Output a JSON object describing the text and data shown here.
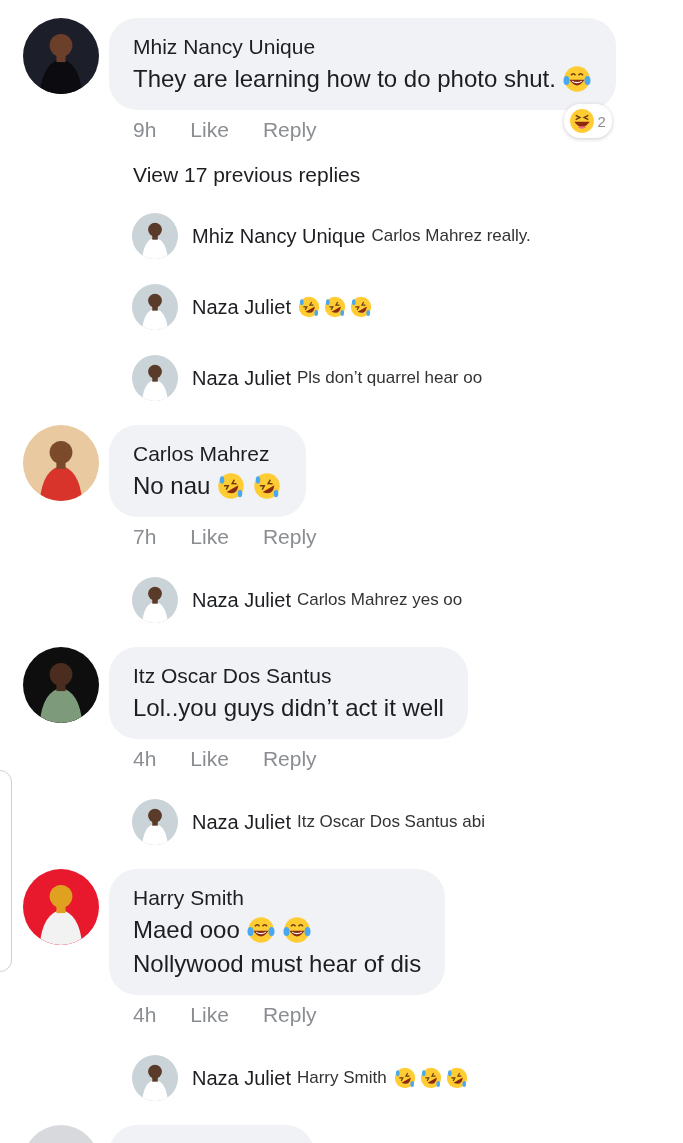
{
  "comments": [
    {
      "kind": "full",
      "author": "Mhiz Nancy Unique",
      "lines": [
        {
          "text": "They are learning how to do photo shut.",
          "emojis": [
            {
              "kind": "tears-of-joy"
            }
          ]
        }
      ],
      "time": "9h",
      "like": "Like",
      "reply": "Reply",
      "reaction": {
        "kind": "grinning-squint",
        "count": "2"
      },
      "view_replies": "View 17 previous replies",
      "replies": [
        {
          "author": "Mhiz Nancy Unique",
          "text": "Carlos Mahrez really."
        },
        {
          "author": "Naza Juliet",
          "emojis": [
            {
              "kind": "rolling-laugh"
            },
            {
              "kind": "rolling-laugh"
            },
            {
              "kind": "rolling-laugh"
            }
          ]
        },
        {
          "author": "Naza Juliet",
          "text": "Pls don’t quarrel hear oo"
        }
      ]
    },
    {
      "kind": "full",
      "author": "Carlos Mahrez",
      "lines": [
        {
          "text": "No nau",
          "emojis": [
            {
              "kind": "rolling-laugh"
            },
            {
              "kind": "rolling-laugh"
            }
          ]
        }
      ],
      "time": "7h",
      "like": "Like",
      "reply": "Reply",
      "replies": [
        {
          "author": "Naza Juliet",
          "text": "Carlos Mahrez yes oo"
        }
      ]
    },
    {
      "kind": "full",
      "author": "Itz Oscar Dos Santus",
      "lines": [
        {
          "text": "Lol..you guys didn’t act it well"
        }
      ],
      "time": "4h",
      "like": "Like",
      "reply": "Reply",
      "replies": [
        {
          "author": "Naza Juliet",
          "text": "Itz Oscar Dos Santus abi"
        }
      ]
    },
    {
      "kind": "full",
      "author": "Harry Smith",
      "lines": [
        {
          "text": "Maed ooo",
          "emojis": [
            {
              "kind": "tears-of-joy"
            },
            {
              "kind": "tears-of-joy"
            }
          ]
        },
        {
          "text": "Nollywood must hear of dis"
        }
      ],
      "time": "4h",
      "like": "Like",
      "reply": "Reply",
      "replies": [
        {
          "author": "Naza Juliet",
          "text": "Harry Smith",
          "emojis": [
            {
              "kind": "rolling-laugh"
            },
            {
              "kind": "rolling-laugh"
            },
            {
              "kind": "rolling-laugh"
            }
          ]
        }
      ]
    },
    {
      "kind": "cut_off"
    }
  ]
}
